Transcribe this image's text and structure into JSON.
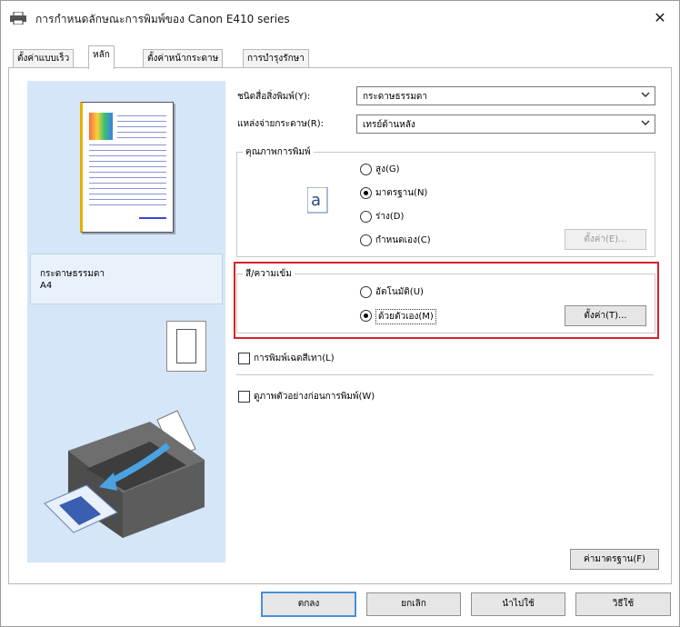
{
  "window": {
    "title": "การกำหนดลักษณะการพิมพ์ของ Canon E410 series",
    "close_glyph": "✕"
  },
  "tabs": [
    {
      "label": "ตั้งค่าแบบเร็ว",
      "active": false
    },
    {
      "label": "หลัก",
      "active": true
    },
    {
      "label": "ตั้งค่าหน้ากระดาษ",
      "active": false
    },
    {
      "label": "การบำรุงรักษา",
      "active": false
    }
  ],
  "preview": {
    "paper_type": "กระดาษธรรมดา",
    "paper_size": "A4"
  },
  "media_type": {
    "label": "ชนิดสื่อสิ่งพิมพ์(Y):",
    "value": "กระดาษธรรมดา"
  },
  "paper_source": {
    "label": "แหล่งจ่ายกระดาษ(R):",
    "value": "เทรย์ด้านหลัง"
  },
  "print_quality": {
    "title": "คุณภาพการพิมพ์",
    "options": [
      "สูง(G)",
      "มาตรฐาน(N)",
      "ร่าง(D)",
      "กำหนดเอง(C)"
    ],
    "selected_index": 1,
    "set_button": "ตั้งค่า(E)..."
  },
  "color_intensity": {
    "title": "สี/ความเข้ม",
    "options": [
      "อัตโนมัติ(U)",
      "ด้วยตัวเอง(M)"
    ],
    "selected_index": 1,
    "set_button": "ตั้งค่า(T)..."
  },
  "grayscale_printing": {
    "label": "การพิมพ์เฉดสีเทา(L)",
    "checked": false
  },
  "preview_before_print": {
    "label": "ดูภาพตัวอย่างก่อนการพิมพ์(W)",
    "checked": false
  },
  "defaults_button": "ค่ามาตรฐาน(F)",
  "footer": {
    "ok": "ตกลง",
    "cancel": "ยกเลิก",
    "apply": "นำไปใช้",
    "help": "วิธีใช้"
  },
  "colors": {
    "preview_bg": "#d4e6f7",
    "highlight_border": "#d4222a",
    "default_button_border": "#4a8fd9"
  }
}
